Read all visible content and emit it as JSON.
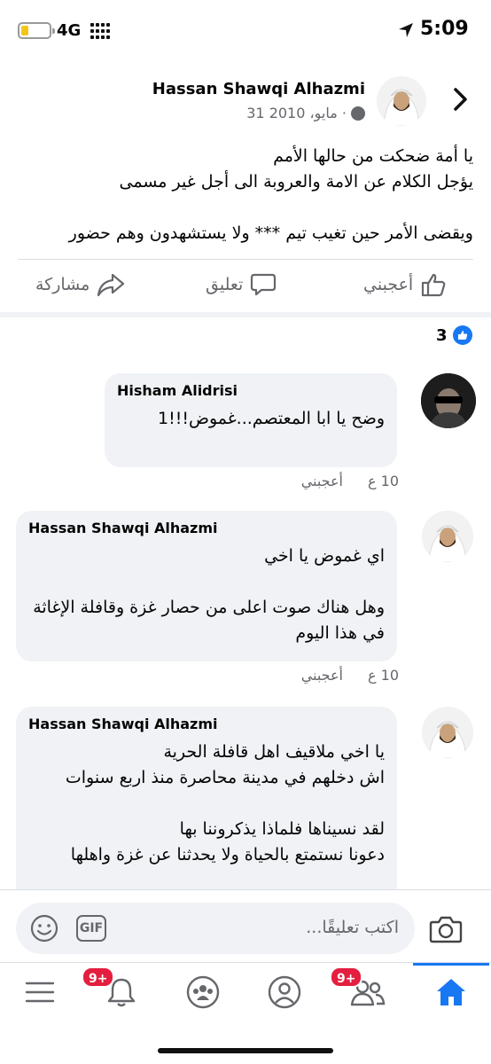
{
  "status_bar": {
    "network": "4G",
    "time": "5:09",
    "battery_level": 0.25,
    "battery_color": "#f2c619"
  },
  "post": {
    "author": "Hassan Shawqi Alhazmi",
    "date": "31 مايو، 2010 ·",
    "privacy_icon": "globe-icon",
    "text_lines": [
      "يا أمة ضحكت من حالها الأمم",
      "يؤجل الكلام عن الامة والعروبة الى أجل غير مسمى",
      "",
      "ويقضى الأمر حين تغيب تيم *** ولا يستشهدون وهم حضور"
    ],
    "actions": {
      "like": "أعجبني",
      "comment": "تعليق",
      "share": "مشاركة"
    },
    "reaction_count": "3"
  },
  "comments": [
    {
      "author": "Hisham Alidrisi",
      "lines": [
        "وضح يا ابا المعتصم...غموض!!!1"
      ],
      "time": "10 ع",
      "like": "أعجبني"
    },
    {
      "author": "Hassan Shawqi Alhazmi",
      "lines": [
        "اي غموض يا اخي",
        "",
        "وهل هناك صوت اعلى من حصار غزة وقافلة الإغاثة في هذا اليوم"
      ],
      "time": "10 ع",
      "like": "أعجبني"
    },
    {
      "author": "Hassan Shawqi Alhazmi",
      "lines": [
        "يا اخي ملاقيف اهل قافلة الحرية",
        "اش دخلهم في مدينة محاصرة منذ اربع سنوات",
        "",
        "لقد نسيناها فلماذا يذكروننا بها",
        "دعونا نستمتع بالحياة ولا يحدثنا عن غزة واهلها"
      ]
    }
  ],
  "composer": {
    "placeholder": "اكتب تعليقًا...",
    "gif_label": "GIF"
  },
  "tabbar": {
    "items": [
      "menu",
      "notifications",
      "groups",
      "profile",
      "friends",
      "home"
    ],
    "notifications_badge": "9+",
    "friends_badge": "9+",
    "accent": "#1877f2"
  },
  "colors": {
    "accent": "#1877f2",
    "badge": "#e41e3f",
    "bubble": "#f0f2f5",
    "secondary_text": "#65676b"
  }
}
